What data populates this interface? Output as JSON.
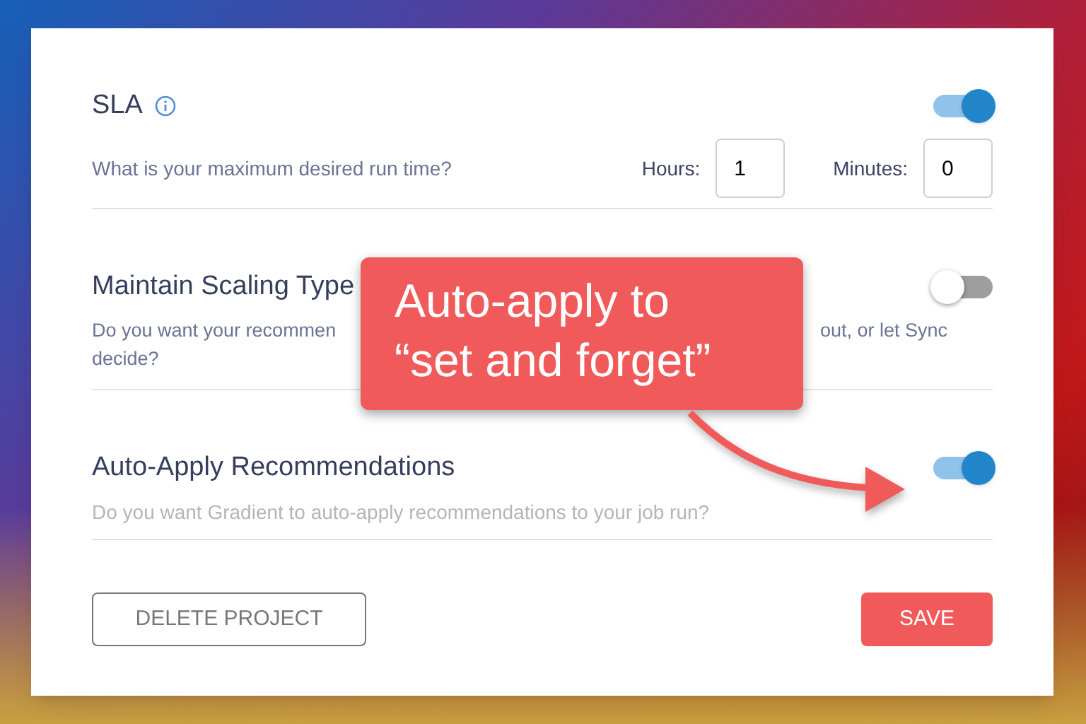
{
  "sections": [
    {
      "kind": "time",
      "title": "SLA",
      "on": true,
      "description": [
        "What is your maximum desired run time?"
      ],
      "fields": [
        {
          "label": "Hours:",
          "value": "1"
        },
        {
          "label": "Minutes:",
          "value": "0"
        }
      ]
    },
    {
      "kind": "covered",
      "title": "Maintain Scaling Type",
      "on": false,
      "description": [
        "Do you want your recommen",
        "out, or let Sync",
        "decide?"
      ]
    },
    {
      "kind": "plain",
      "title": "Auto-Apply Recommendations",
      "on": true,
      "description": [
        "Do you want Gradient to auto-apply recommendations to your job run?"
      ]
    }
  ],
  "buttons": [
    {
      "kind": "outline",
      "label": "DELETE PROJECT"
    },
    {
      "kind": "primary",
      "label": "SAVE"
    }
  ],
  "callout": {
    "lines": [
      "Auto-apply to",
      "“set and forget”"
    ]
  }
}
